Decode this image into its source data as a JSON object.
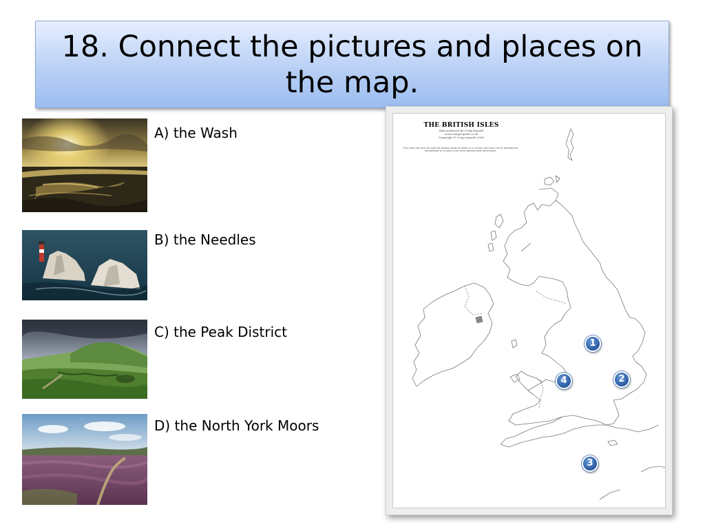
{
  "slide": {
    "title": "18. Connect the pictures and places on the map."
  },
  "pictures": [
    {
      "id": "A",
      "label": "A) the Wash",
      "icon": "wash-photo"
    },
    {
      "id": "B",
      "label": "B) the Needles",
      "icon": "needles-photo"
    },
    {
      "id": "C",
      "label": "C) the Peak District",
      "icon": "peak-district-photo"
    },
    {
      "id": "D",
      "label": "D) the North York Moors",
      "icon": "north-york-moors-photo"
    }
  ],
  "map": {
    "title": "THE BRITISH ISLES",
    "produced_by": "Map produced by Craig Asquith",
    "website": "www.craigasquith.co.uk",
    "copyright": "Copyright © Craig Asquith 2006",
    "note": "This map may only be used for private study at home or in school, and may not be reproduced, republished or re-sold in any form without prior permission.",
    "markers": [
      "1",
      "2",
      "3",
      "4"
    ]
  },
  "colors": {
    "title_gradient_top": "#e7efff",
    "title_gradient_bottom": "#9cbdf0",
    "marker_blue": "#2f62a8"
  }
}
